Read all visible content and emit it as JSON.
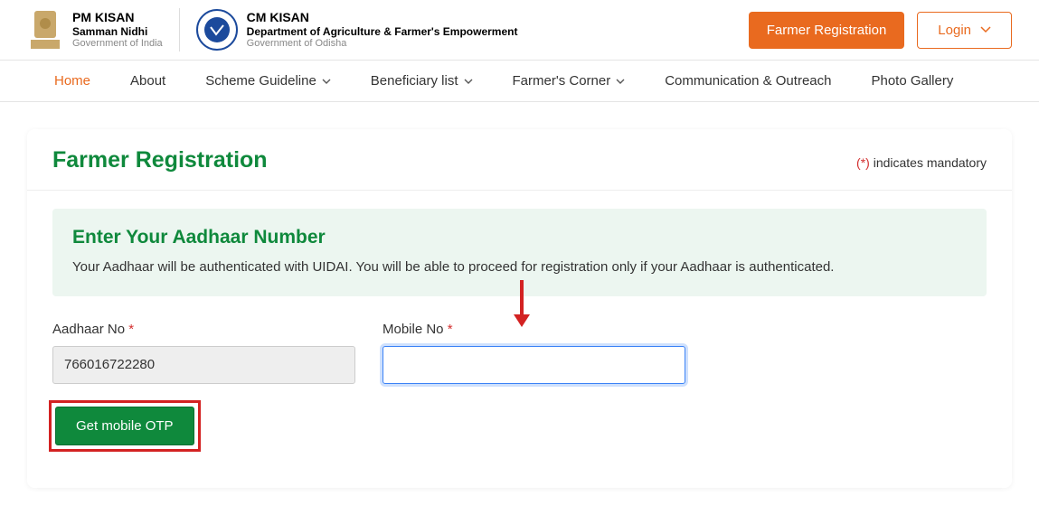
{
  "header": {
    "pm": {
      "title": "PM KISAN",
      "sub": "Samman Nidhi",
      "gov": "Government of India"
    },
    "cm": {
      "title": "CM KISAN",
      "sub": "Department of Agriculture & Farmer's Empowerment",
      "gov": "Government of Odisha"
    },
    "register_btn": "Farmer Registration",
    "login_btn": "Login"
  },
  "nav": {
    "home": "Home",
    "about": "About",
    "scheme": "Scheme Guideline",
    "beneficiary": "Beneficiary list",
    "corner": "Farmer's Corner",
    "comm": "Communication & Outreach",
    "gallery": "Photo Gallery"
  },
  "page": {
    "title": "Farmer Registration",
    "mandatory_star": "(*)",
    "mandatory_text": " indicates mandatory"
  },
  "info": {
    "title": "Enter Your Aadhaar Number",
    "text": "Your Aadhaar will be authenticated with UIDAI. You will be able to proceed for registration only if your Aadhaar is authenticated."
  },
  "form": {
    "aadhaar_label": "Aadhaar No ",
    "aadhaar_value": "766016722280",
    "mobile_label": "Mobile No ",
    "mobile_value": "",
    "get_otp": "Get mobile OTP"
  }
}
